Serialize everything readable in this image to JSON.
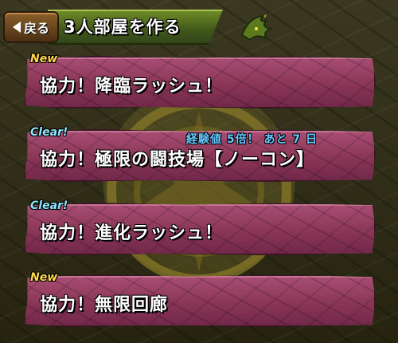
{
  "header": {
    "back_label": "戻る",
    "title": "3人部屋を作る"
  },
  "colors": {
    "new_tag": "#ffd84a",
    "clear_tag": "#8fe6ff",
    "bonus": "#66c8ff",
    "plate": "#8a3656"
  },
  "icons": {
    "back": "left-arrow-icon",
    "corner": "dragon-icon",
    "background": "emblem-icon"
  },
  "dungeons": [
    {
      "tag": "New",
      "title": "協力！降臨ラッシュ！",
      "bonus": ""
    },
    {
      "tag": "Clear!",
      "title": "協力！極限の闘技場【ノーコン】",
      "bonus": "経験値 5倍！ あと 7 日"
    },
    {
      "tag": "Clear!",
      "title": "協力！進化ラッシュ！",
      "bonus": ""
    },
    {
      "tag": "New",
      "title": "協力！無限回廊",
      "bonus": ""
    }
  ]
}
